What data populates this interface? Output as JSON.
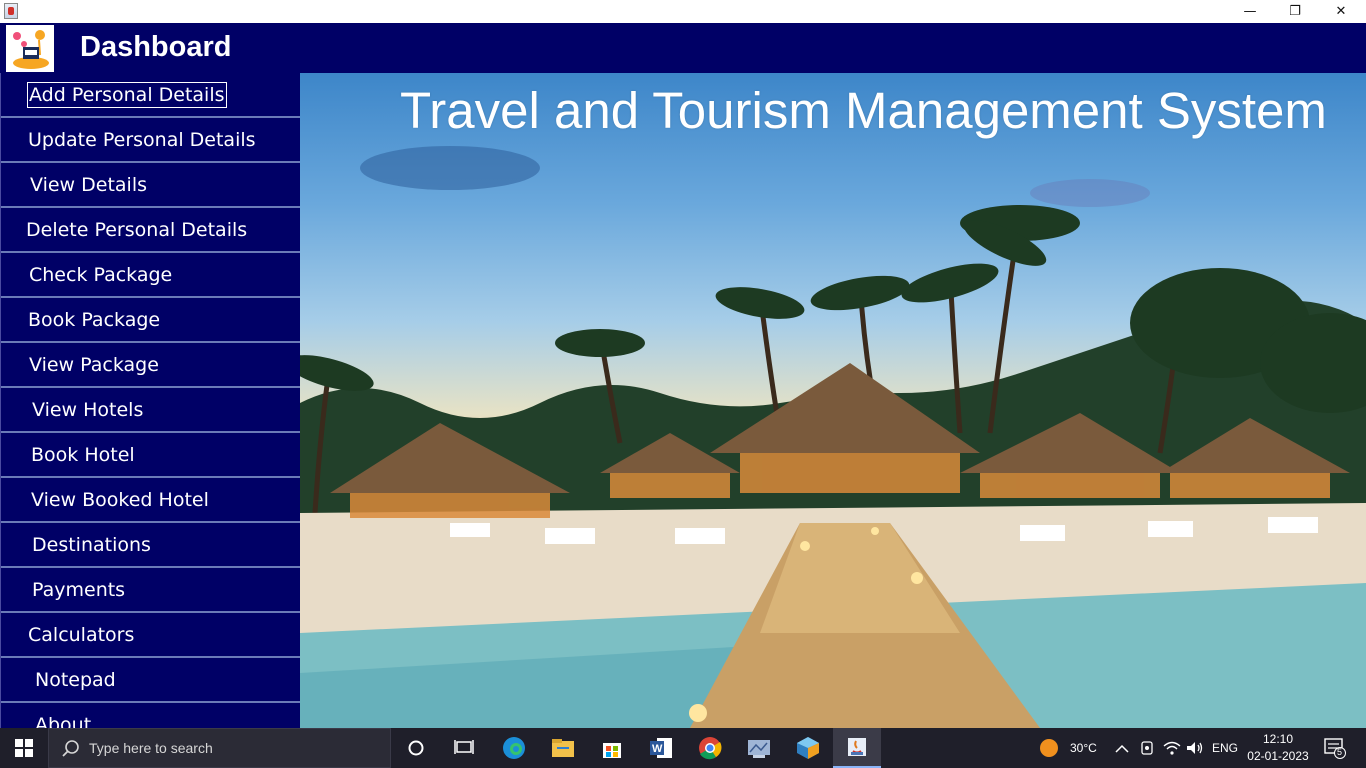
{
  "window": {
    "minimize_glyph": "—",
    "maximize_glyph": "❐",
    "close_glyph": "✕"
  },
  "header": {
    "title": "Dashboard"
  },
  "sidebar": {
    "items": [
      {
        "label": "Add Personal Details"
      },
      {
        "label": "Update Personal Details"
      },
      {
        "label": "View Details"
      },
      {
        "label": "Delete Personal Details"
      },
      {
        "label": "Check Package"
      },
      {
        "label": "Book Package"
      },
      {
        "label": "View Package"
      },
      {
        "label": "View Hotels"
      },
      {
        "label": "Book Hotel"
      },
      {
        "label": "View Booked Hotel"
      },
      {
        "label": "Destinations"
      },
      {
        "label": "Payments"
      },
      {
        "label": "Calculators"
      },
      {
        "label": "Notepad"
      },
      {
        "label": "About"
      }
    ]
  },
  "main": {
    "title": "Travel and Tourism Management System"
  },
  "taskbar": {
    "search_placeholder": "Type here to search",
    "weather": "30°C",
    "language": "ENG",
    "time": "12:10",
    "date": "02-01-2023",
    "notification_count": "5"
  },
  "colors": {
    "header_bg": "#000066",
    "sidebar_bg": "#000066",
    "taskbar_bg": "#1f1f2a"
  }
}
